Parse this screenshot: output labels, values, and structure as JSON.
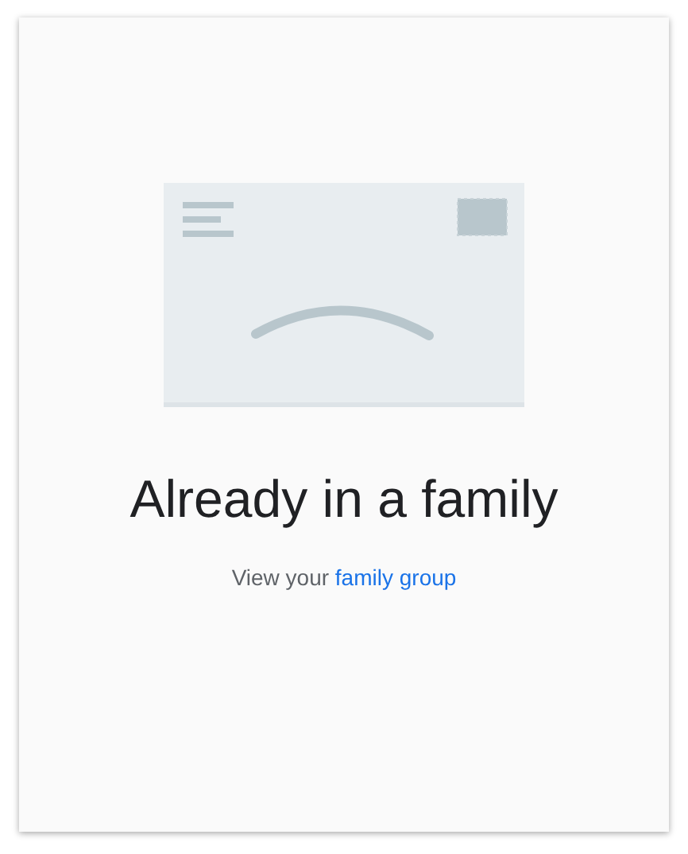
{
  "title": "Already in a family",
  "message": {
    "text": "View your",
    "link": "family group"
  }
}
